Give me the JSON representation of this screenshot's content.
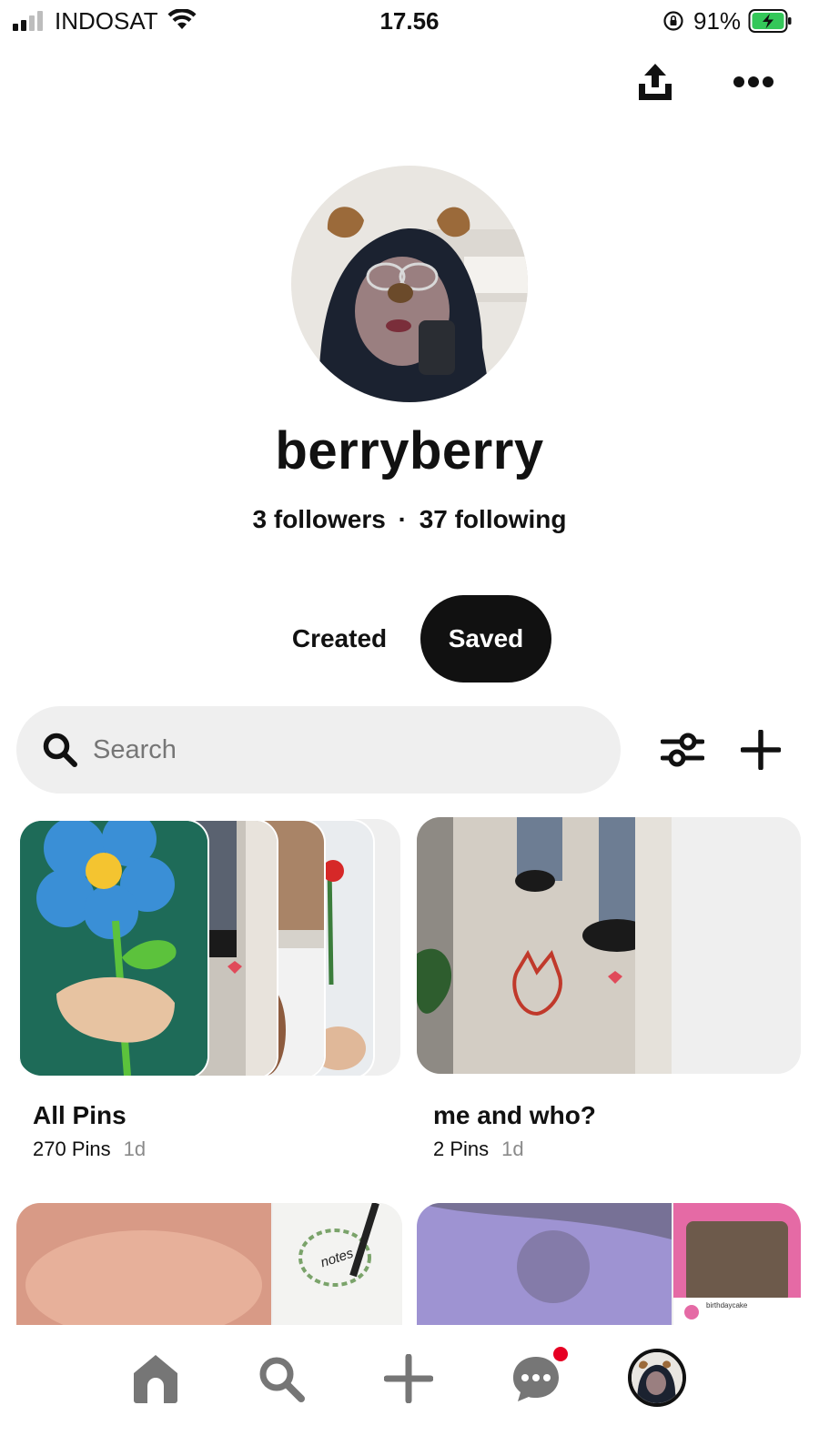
{
  "status_bar": {
    "carrier": "INDOSAT",
    "time": "17.56",
    "battery_percent": "91%",
    "battery_level": 0.91,
    "battery_color": "#34c759"
  },
  "profile": {
    "display_name": "berryberry",
    "followers_text": "3 followers",
    "separator": "·",
    "following_text": "37 following"
  },
  "tabs": [
    {
      "label": "Created",
      "active": false
    },
    {
      "label": "Saved",
      "active": true
    }
  ],
  "search": {
    "placeholder": "Search",
    "value": ""
  },
  "toolbar_icons": [
    "share-icon",
    "more-icon",
    "filter-icon",
    "add-icon"
  ],
  "boards": [
    {
      "title": "All Pins",
      "count": "270 Pins",
      "age": "1d"
    },
    {
      "title": "me and who?",
      "count": "2 Pins",
      "age": "1d"
    }
  ],
  "second_row_preview": {
    "notes_word": "notes",
    "caption_line1": "birthdaycake"
  },
  "bottom_nav": [
    {
      "icon": "home-icon"
    },
    {
      "icon": "search-icon"
    },
    {
      "icon": "plus-icon"
    },
    {
      "icon": "messages-icon",
      "badge": true
    },
    {
      "icon": "profile-avatar"
    }
  ],
  "colors": {
    "accent_dark": "#111111",
    "notification_badge": "#e60023",
    "search_bg": "#efefef",
    "nav_icon": "#767676"
  }
}
